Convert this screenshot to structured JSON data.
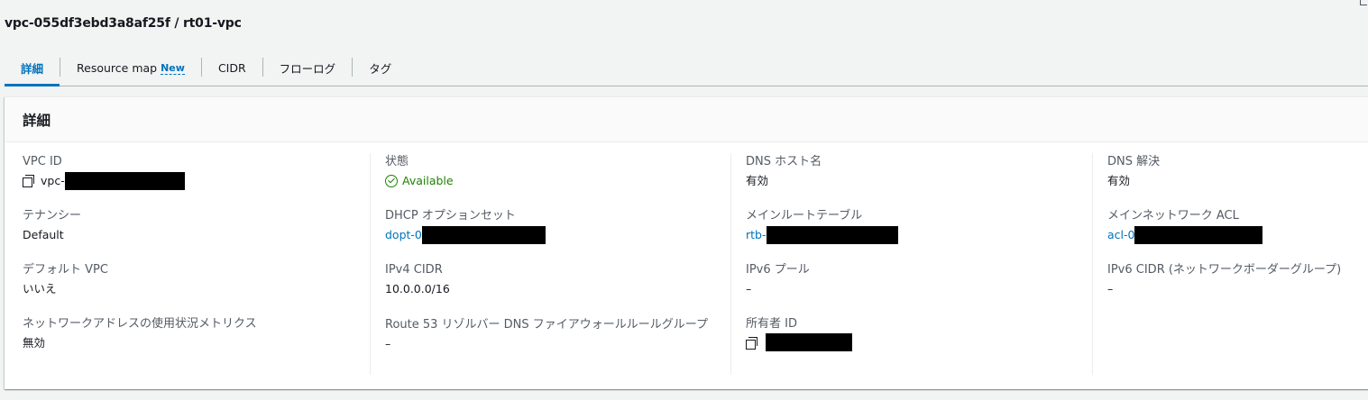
{
  "page": {
    "title": "vpc-055df3ebd3a8af25f / rt01-vpc"
  },
  "tabs": [
    {
      "label": "詳細",
      "active": true
    },
    {
      "label": "Resource map",
      "badge": "New"
    },
    {
      "label": "CIDR"
    },
    {
      "label": "フローログ"
    },
    {
      "label": "タグ"
    }
  ],
  "details": {
    "title": "詳細",
    "vpc_id": {
      "label": "VPC ID",
      "value": "vpc-"
    },
    "tenancy": {
      "label": "テナンシー",
      "value": "Default"
    },
    "default_vpc": {
      "label": "デフォルト VPC",
      "value": "いいえ"
    },
    "network_metrics": {
      "label": "ネットワークアドレスの使用状況メトリクス",
      "value": "無効"
    },
    "state": {
      "label": "状態",
      "value": "Available",
      "color": "#1d8102"
    },
    "dhcp": {
      "label": "DHCP オプションセット",
      "value": "dopt-0"
    },
    "ipv4_cidr": {
      "label": "IPv4 CIDR",
      "value": "10.0.0.0/16"
    },
    "route53": {
      "label": "Route 53 リゾルバー DNS ファイアウォールルールグループ",
      "value": "–"
    },
    "dns_hostnames": {
      "label": "DNS ホスト名",
      "value": "有効"
    },
    "main_route_table": {
      "label": "メインルートテーブル",
      "value": "rtb-"
    },
    "ipv6_pool": {
      "label": "IPv6 プール",
      "value": "–"
    },
    "owner_id": {
      "label": "所有者 ID",
      "value": ""
    },
    "dns_resolution": {
      "label": "DNS 解決",
      "value": "有効"
    },
    "main_network_acl": {
      "label": "メインネットワーク ACL",
      "value": "acl-0"
    },
    "ipv6_cidr": {
      "label": "IPv6 CIDR (ネットワークボーダーグループ)",
      "value": "–"
    }
  }
}
